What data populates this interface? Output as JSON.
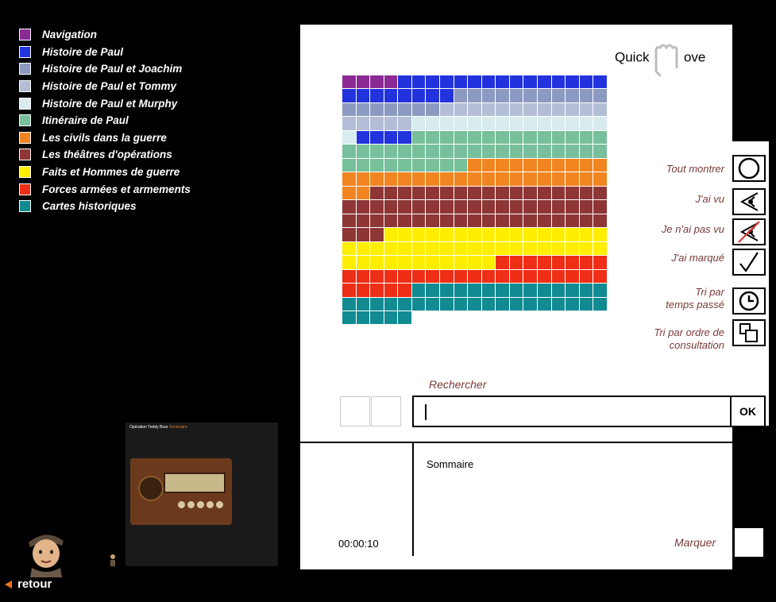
{
  "legend": [
    {
      "label": "Navigation",
      "color": "#8b2a95"
    },
    {
      "label": "Histoire de Paul",
      "color": "#2233dd"
    },
    {
      "label": "Histoire de Paul et Joachim",
      "color": "#8c99c0"
    },
    {
      "label": "Histoire de Paul et Tommy",
      "color": "#b3bed6"
    },
    {
      "label": "Histoire de Paul et Murphy",
      "color": "#d8ecee"
    },
    {
      "label": "Itinéraire de Paul",
      "color": "#78bf9b"
    },
    {
      "label": "Les civils dans la guerre",
      "color": "#f08521"
    },
    {
      "label": "Les théâtres d'opérations",
      "color": "#8e3535"
    },
    {
      "label": "Faits et Hommes de guerre",
      "color": "#ffee00"
    },
    {
      "label": "Forces armées et armements",
      "color": "#ee2e16"
    },
    {
      "label": "Cartes historiques",
      "color": "#118a91"
    }
  ],
  "logo": {
    "quick": "Quick",
    "move": "ove",
    "symbol": "hand-m-icon"
  },
  "content_grid": {
    "columns": 19,
    "rows": [
      [
        0,
        0,
        0,
        0,
        1,
        1,
        1,
        1,
        1,
        1,
        1,
        1,
        1,
        1,
        1,
        1,
        1,
        1,
        1
      ],
      [
        1,
        1,
        1,
        1,
        1,
        1,
        1,
        1,
        2,
        2,
        2,
        2,
        2,
        2,
        2,
        2,
        2,
        2,
        2
      ],
      [
        2,
        2,
        2,
        2,
        2,
        2,
        2,
        3,
        3,
        3,
        3,
        3,
        3,
        3,
        3,
        3,
        3,
        3,
        3
      ],
      [
        3,
        3,
        3,
        3,
        3,
        4,
        4,
        4,
        4,
        4,
        4,
        4,
        4,
        4,
        4,
        4,
        4,
        4,
        4
      ],
      [
        4,
        1,
        1,
        1,
        1,
        5,
        5,
        5,
        5,
        5,
        5,
        5,
        5,
        5,
        5,
        5,
        5,
        5,
        5
      ],
      [
        5,
        5,
        5,
        5,
        5,
        5,
        5,
        5,
        5,
        5,
        5,
        5,
        5,
        5,
        5,
        5,
        5,
        5,
        5
      ],
      [
        5,
        5,
        5,
        5,
        5,
        5,
        5,
        5,
        5,
        6,
        6,
        6,
        6,
        6,
        6,
        6,
        6,
        6,
        6
      ],
      [
        6,
        6,
        6,
        6,
        6,
        6,
        6,
        6,
        6,
        6,
        6,
        6,
        6,
        6,
        6,
        6,
        6,
        6,
        6
      ],
      [
        6,
        6,
        7,
        7,
        7,
        7,
        7,
        7,
        7,
        7,
        7,
        7,
        7,
        7,
        7,
        7,
        7,
        7,
        7
      ],
      [
        7,
        7,
        7,
        7,
        7,
        7,
        7,
        7,
        7,
        7,
        7,
        7,
        7,
        7,
        7,
        7,
        7,
        7,
        7
      ],
      [
        7,
        7,
        7,
        7,
        7,
        7,
        7,
        7,
        7,
        7,
        7,
        7,
        7,
        7,
        7,
        7,
        7,
        7,
        7
      ],
      [
        7,
        7,
        7,
        8,
        8,
        8,
        8,
        8,
        8,
        8,
        8,
        8,
        8,
        8,
        8,
        8,
        8,
        8,
        8
      ],
      [
        8,
        8,
        8,
        8,
        8,
        8,
        8,
        8,
        8,
        8,
        8,
        8,
        8,
        8,
        8,
        8,
        8,
        8,
        8
      ],
      [
        8,
        8,
        8,
        8,
        8,
        8,
        8,
        8,
        8,
        8,
        8,
        9,
        9,
        9,
        9,
        9,
        9,
        9,
        9
      ],
      [
        9,
        9,
        9,
        9,
        9,
        9,
        9,
        9,
        9,
        9,
        9,
        9,
        9,
        9,
        9,
        9,
        9,
        9,
        9
      ],
      [
        9,
        9,
        9,
        9,
        9,
        10,
        10,
        10,
        10,
        10,
        10,
        10,
        10,
        10,
        10,
        10,
        10,
        10,
        10
      ],
      [
        10,
        10,
        10,
        10,
        10,
        10,
        10,
        10,
        10,
        10,
        10,
        10,
        10,
        10,
        10,
        10,
        10,
        10,
        10
      ],
      [
        10,
        10,
        10,
        10,
        10
      ]
    ]
  },
  "filters": [
    {
      "label": "Tout montrer",
      "icon": "circle-icon"
    },
    {
      "label": "J'ai vu",
      "icon": "eye-icon"
    },
    {
      "label": "Je n'ai pas vu",
      "icon": "eye-crossed-icon"
    },
    {
      "label": "J'ai marqué",
      "icon": "checkmark-icon"
    }
  ],
  "sorts": [
    {
      "line1": "Tri par",
      "line2": "temps passé",
      "icon": "clock-icon"
    },
    {
      "line1": "Tri par ordre de",
      "line2": "consultation",
      "icon": "stacked-windows-icon"
    }
  ],
  "search": {
    "label": "Rechercher",
    "value": "",
    "ok_label": "OK"
  },
  "timer": "00:00:10",
  "current_section": "Sommaire",
  "mark": {
    "label": "Marquer"
  },
  "preview": {
    "title": "Opération Teddy Bear",
    "subtitle": "Sommaire"
  },
  "nav": {
    "back_label": "retour",
    "arrow_color": "#e8731e"
  }
}
